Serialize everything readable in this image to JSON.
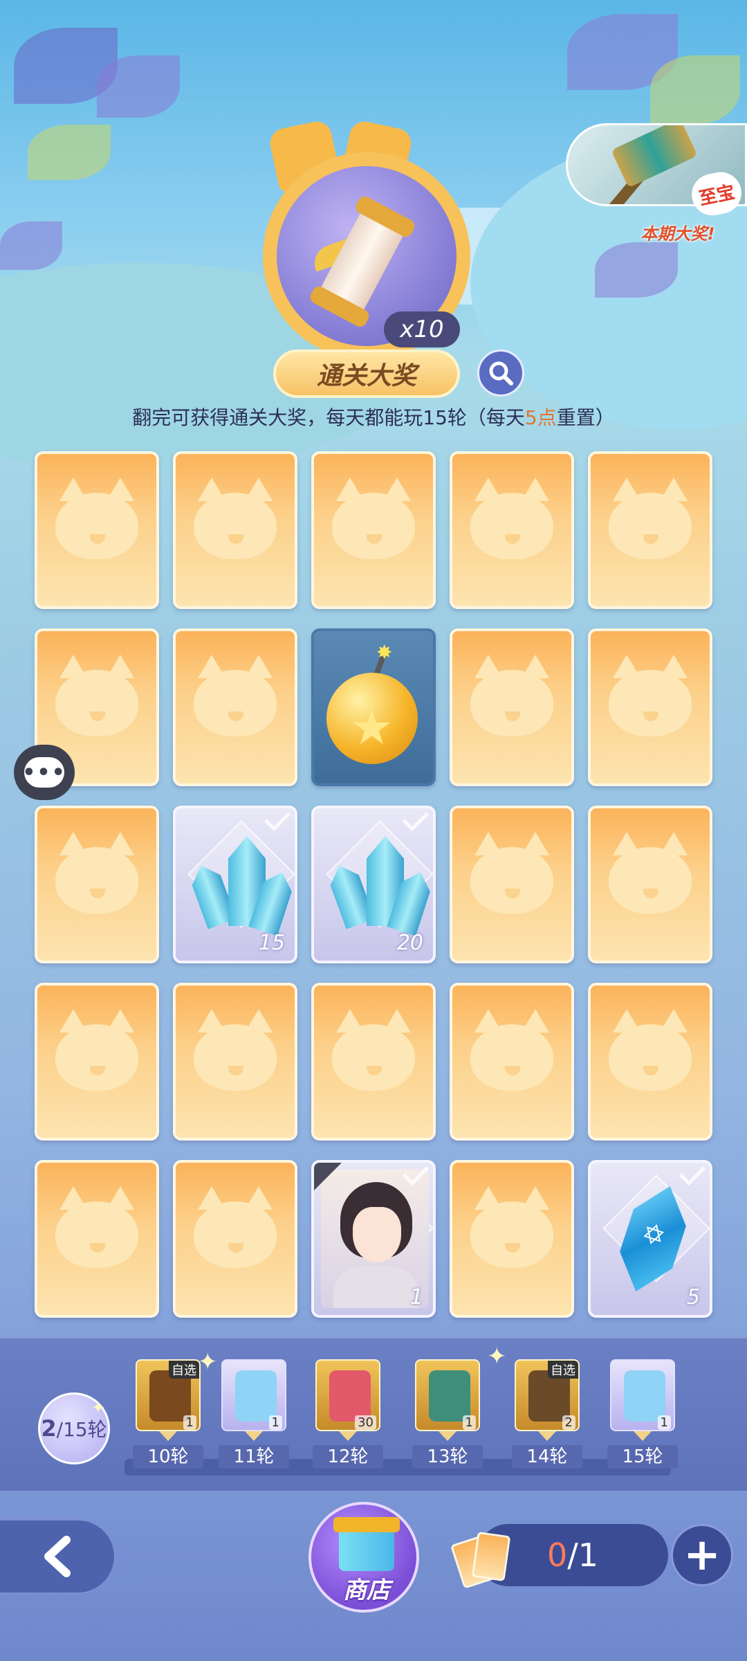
{
  "grand_prize": {
    "multiplier": "x10",
    "label": "通关大奖"
  },
  "jackpot": {
    "tag": "至宝",
    "label": "本期大奖!"
  },
  "info": {
    "text_before": "翻完可获得通关大奖，每天都能玩15轮（每天",
    "highlight": "5点",
    "text_after": "重置）"
  },
  "grid": {
    "cards": [
      {
        "state": "hidden"
      },
      {
        "state": "hidden"
      },
      {
        "state": "hidden"
      },
      {
        "state": "hidden"
      },
      {
        "state": "hidden"
      },
      {
        "state": "hidden"
      },
      {
        "state": "hidden"
      },
      {
        "state": "bomb"
      },
      {
        "state": "hidden"
      },
      {
        "state": "hidden"
      },
      {
        "state": "hidden"
      },
      {
        "state": "crystal",
        "qty": "15"
      },
      {
        "state": "crystal",
        "qty": "20"
      },
      {
        "state": "hidden"
      },
      {
        "state": "hidden"
      },
      {
        "state": "hidden"
      },
      {
        "state": "hidden"
      },
      {
        "state": "hidden"
      },
      {
        "state": "hidden"
      },
      {
        "state": "hidden"
      },
      {
        "state": "hidden"
      },
      {
        "state": "hidden"
      },
      {
        "state": "character",
        "qty": "1"
      },
      {
        "state": "hidden"
      },
      {
        "state": "gem",
        "qty": "5"
      }
    ]
  },
  "progress": {
    "current": "2",
    "total": "/15轮",
    "rewards": [
      {
        "round": "10轮",
        "count": "1",
        "tag": "自选",
        "style": "gold"
      },
      {
        "round": "11轮",
        "count": "1",
        "tag": "",
        "style": "purple"
      },
      {
        "round": "12轮",
        "count": "30",
        "tag": "",
        "style": "gold"
      },
      {
        "round": "13轮",
        "count": "1",
        "tag": "",
        "style": "gold"
      },
      {
        "round": "14轮",
        "count": "2",
        "tag": "自选",
        "style": "gold"
      },
      {
        "round": "15轮",
        "count": "1",
        "tag": "",
        "style": "purple"
      }
    ]
  },
  "bottom": {
    "shop_label": "商店",
    "cards_current": "0",
    "cards_total": "/1",
    "plus": "+"
  },
  "icons": {
    "back": "chevron-left-icon",
    "search": "search-icon",
    "chat": "chat-bubble-icon",
    "shop": "gift-icon"
  },
  "colors": {
    "card_back": "#fbb35a",
    "highlight": "#e0762e",
    "counter_current": "#ff7b5a"
  }
}
